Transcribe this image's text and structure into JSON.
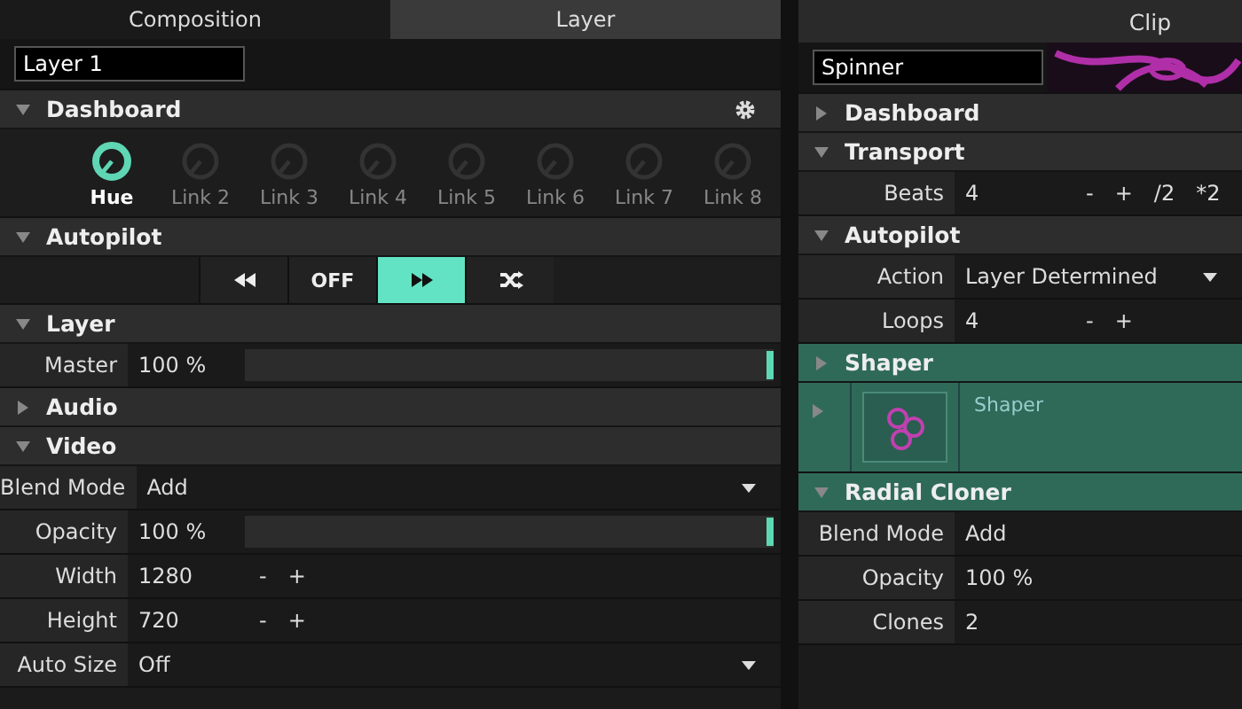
{
  "left_panel": {
    "tabs": [
      {
        "label": "Composition",
        "selected": false
      },
      {
        "label": "Layer",
        "selected": true
      }
    ],
    "name_field": {
      "value": "Layer 1"
    },
    "sections": [
      {
        "title": "Dashboard",
        "expanded": true,
        "highlighted": false,
        "settings_button": true,
        "items": [
          {
            "kind": "knobs",
            "knobs": [
              {
                "label": "Hue",
                "active": true
              },
              {
                "label": "Link 2",
                "active": false
              },
              {
                "label": "Link 3",
                "active": false
              },
              {
                "label": "Link 4",
                "active": false
              },
              {
                "label": "Link 5",
                "active": false
              },
              {
                "label": "Link 6",
                "active": false
              },
              {
                "label": "Link 7",
                "active": false
              },
              {
                "label": "Link 8",
                "active": false
              }
            ]
          }
        ]
      },
      {
        "title": "Autopilot",
        "expanded": true,
        "highlighted": false,
        "items": [
          {
            "kind": "transport",
            "options": [
              {
                "kind": "rewind",
                "selected": false
              },
              {
                "kind": "text",
                "label": "OFF",
                "selected": false
              },
              {
                "kind": "forward",
                "selected": true
              },
              {
                "kind": "shuffle",
                "selected": false
              }
            ]
          }
        ]
      },
      {
        "title": "Layer",
        "expanded": true,
        "highlighted": false,
        "items": [
          {
            "kind": "slider",
            "label": "Master",
            "value": "100 %",
            "level": 1
          }
        ]
      },
      {
        "title": "Audio",
        "expanded": false,
        "highlighted": false
      },
      {
        "title": "Video",
        "expanded": true,
        "highlighted": false,
        "items": [
          {
            "kind": "dropdown",
            "label": "Blend Mode",
            "value": "Add"
          },
          {
            "kind": "slider",
            "label": "Opacity",
            "value": "100 %",
            "level": 1
          },
          {
            "kind": "stepper",
            "label": "Width",
            "value": "1280",
            "buttons": [
              "-",
              "+"
            ]
          },
          {
            "kind": "stepper",
            "label": "Height",
            "value": "720",
            "buttons": [
              "-",
              "+"
            ]
          },
          {
            "kind": "dropdown",
            "label": "Auto Size",
            "value": "Off"
          }
        ]
      }
    ]
  },
  "right_panel": {
    "title": "Clip",
    "name_field": {
      "value": "Spinner"
    },
    "sections": [
      {
        "title": "Dashboard",
        "expanded": false,
        "highlighted": false
      },
      {
        "title": "Transport",
        "expanded": true,
        "highlighted": false,
        "items": [
          {
            "kind": "stepper",
            "label": "Beats",
            "value": "4",
            "buttons": [
              "-",
              "+",
              "/2",
              "*2"
            ]
          }
        ]
      },
      {
        "title": "Autopilot",
        "expanded": true,
        "highlighted": false,
        "items": [
          {
            "kind": "dropdown",
            "label": "Action",
            "value": "Layer Determined"
          },
          {
            "kind": "stepper",
            "label": "Loops",
            "value": "4",
            "buttons": [
              "-",
              "+"
            ]
          }
        ]
      },
      {
        "title": "Shaper",
        "expanded": false,
        "highlighted": true,
        "items": [
          {
            "kind": "effect",
            "label": "Shaper"
          }
        ]
      },
      {
        "title": "Radial Cloner",
        "expanded": true,
        "highlighted": true,
        "items": [
          {
            "kind": "value",
            "label": "Blend Mode",
            "value": "Add"
          },
          {
            "kind": "value",
            "label": "Opacity",
            "value": "100 %"
          },
          {
            "kind": "value",
            "label": "Clones",
            "value": "2"
          }
        ]
      }
    ]
  }
}
